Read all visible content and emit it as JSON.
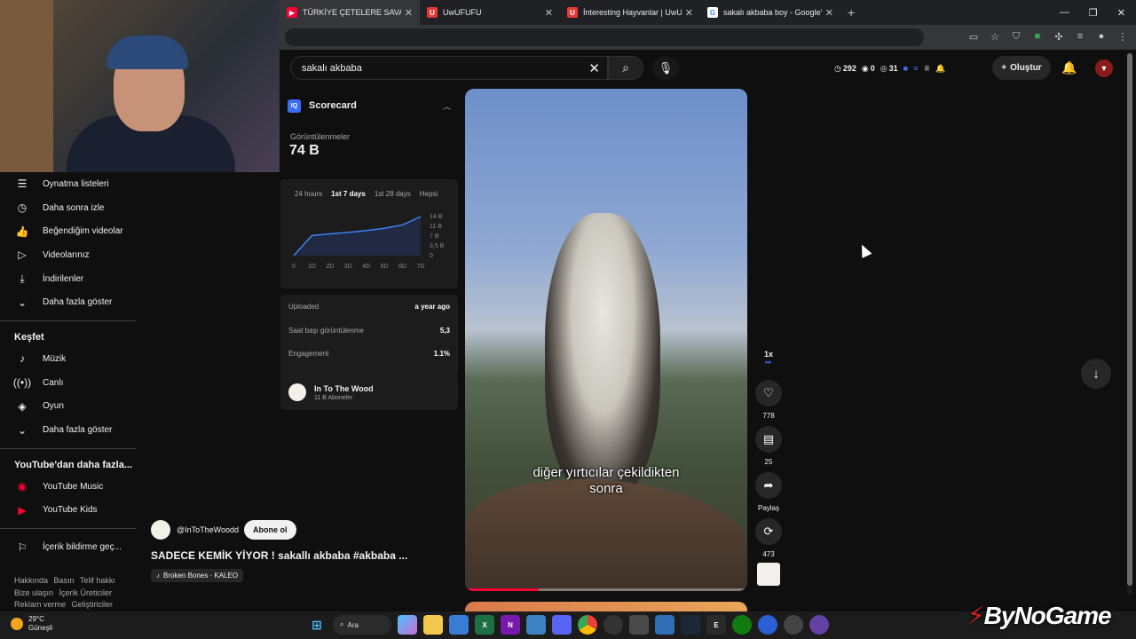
{
  "browser": {
    "tabs": [
      {
        "label": "TÜRKİYE ÇETELERE SAVAŞ AÇTI",
        "icon": "youtube-favicon",
        "color": "#ff0033"
      },
      {
        "label": "UwUFUFU",
        "icon": "uwufufu-favicon",
        "color": "#e53935"
      },
      {
        "label": "İnteresting Hayvanlar | UwUFUFU",
        "icon": "uwufufu-favicon",
        "color": "#e53935"
      },
      {
        "label": "sakalı akbaba boy - Google'da ara",
        "icon": "google-favicon",
        "color": "#ffffff"
      }
    ]
  },
  "youtube": {
    "search": {
      "query": "sakalı akbaba"
    },
    "stats": {
      "watched": "292",
      "views": "0",
      "eye": "31"
    },
    "create_label": "Oluştur",
    "sidebar": {
      "you_items": [
        {
          "label": "Oynatma listeleri",
          "icon": "playlist-icon"
        },
        {
          "label": "Daha sonra izle",
          "icon": "clock-icon"
        },
        {
          "label": "Beğendiğim videolar",
          "icon": "thumbs-up-icon"
        },
        {
          "label": "Videolarınız",
          "icon": "video-icon"
        },
        {
          "label": "İndirilenler",
          "icon": "download-icon"
        },
        {
          "label": "Daha fazla göster",
          "icon": "chevron-down-icon"
        }
      ],
      "explore_title": "Keşfet",
      "explore_items": [
        {
          "label": "Müzik",
          "icon": "music-icon"
        },
        {
          "label": "Canlı",
          "icon": "live-icon"
        },
        {
          "label": "Oyun",
          "icon": "gaming-icon"
        },
        {
          "label": "Daha fazla göster",
          "icon": "chevron-down-icon"
        }
      ],
      "more_title": "YouTube'dan daha fazla...",
      "more_items": [
        {
          "label": "YouTube Music",
          "icon": "youtube-music-icon"
        },
        {
          "label": "YouTube Kids",
          "icon": "youtube-kids-icon"
        }
      ],
      "report_label": "İçerik bildirme geç...",
      "footer": [
        "Hakkında",
        "Basın",
        "Telif hakkı",
        "Bize ulaşın",
        "İçerik Üreticiler",
        "Reklam verme",
        "Geliştiriciler"
      ]
    },
    "scorecard": {
      "title": "Scorecard",
      "views_label": "Görüntülenmeler",
      "views": "74 B",
      "tabs": [
        "24 hours",
        "1st 7 days",
        "1st 28 days",
        "Hepsi"
      ],
      "active_tab": "1st 7 days",
      "x_labels": [
        "0",
        "1D",
        "2D",
        "3D",
        "4D",
        "5D",
        "6D",
        "7D"
      ],
      "y_labels": [
        "14 B",
        "11 B",
        "7 B",
        "3,5 B",
        "0"
      ],
      "stats": [
        {
          "label": "Uploaded",
          "value": "a year ago"
        },
        {
          "label": "Saat başı görüntülenme",
          "value": "5,3"
        },
        {
          "label": "Engagement",
          "value": "1.1%"
        }
      ],
      "channel": {
        "name": "In To The Wood",
        "subs": "11 B Aboneler"
      }
    },
    "video": {
      "caption_line1": "diğer yırtıcılar çekildikten",
      "caption_line2": "sonra",
      "progress": 0.26,
      "speed": "1x",
      "likes": "778",
      "comments": "25",
      "share_label": "Paylaş",
      "remix": "473",
      "channel_handle": "@InToTheWoodd",
      "subscribe_label": "Abone ol",
      "title": "SADECE KEMİK YİYOR ! sakallı akbaba #akbaba ...",
      "music": "Broken Bones · KALEO"
    }
  },
  "taskbar": {
    "temperature": "29°C",
    "weather": "Güneşli",
    "search_label": "Ara"
  },
  "watermark": {
    "brand": "ByNoGame"
  },
  "chart_data": {
    "type": "line",
    "x": [
      "0",
      "1D",
      "2D",
      "3D",
      "4D",
      "5D",
      "6D",
      "7D"
    ],
    "values": [
      0,
      7.2,
      7.8,
      8.3,
      9.0,
      9.8,
      11.0,
      14.0
    ],
    "ylim": [
      0,
      14
    ],
    "y_unit": "B"
  }
}
